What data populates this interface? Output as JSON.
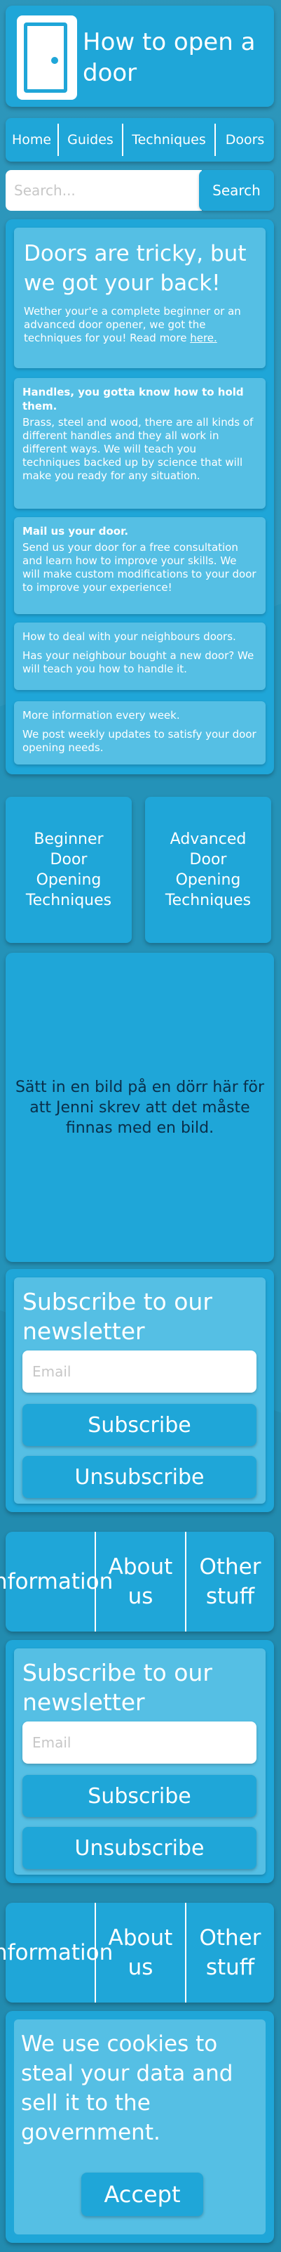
{
  "header": {
    "title": "How to open a door"
  },
  "nav": {
    "items": [
      "Home",
      "Guides",
      "Techniques",
      "Doors"
    ]
  },
  "search": {
    "placeholder": "Search...",
    "button_label": "Search"
  },
  "intro": {
    "title": "Doors are tricky, but we got your back!",
    "text": "Wether your'e a complete beginner or an advanced door opener, we got the techniques for you! Read more ",
    "link": "here."
  },
  "cards": [
    {
      "title": "Handles, you gotta know how to hold them.",
      "text": "Brass, steel and wood, there are all kinds of different handles and they all work in different ways. We will teach you techniques backed up by science that will make you ready for any situation."
    },
    {
      "title": "Mail us your door.",
      "text": "Send us your door for a free consultation and learn how to improve your skills. We will make custom modifications to your door to improve your experience!"
    },
    {
      "title": "How to deal with your neighbours doors.",
      "text": "Has your neighbour bought a new door? We will teach you how to handle it."
    },
    {
      "title": "More information every week.",
      "text": "We post weekly updates to satisfy your door opening needs."
    }
  ],
  "techniques": {
    "beginner": "Beginner Door Opening Techniques",
    "advanced": "Advanced Door Opening Techniques"
  },
  "image_placeholder": "Sätt in en bild på en dörr här för att Jenni skrev att det måste finnas med en bild.",
  "newsletter": {
    "title": "Subscribe to our newsletter",
    "email_placeholder": "Email",
    "subscribe_label": "Subscribe",
    "unsubscribe_label": "Unsubscribe"
  },
  "footer": {
    "items": [
      "Information",
      "About us",
      "Other stuff"
    ]
  },
  "cookie": {
    "text": "We use cookies to steal your data and sell it to the government.",
    "accept_label": "Accept"
  },
  "colors": {
    "background": "#2492b8",
    "primary": "#1fa6d8",
    "card": "#55bfe4"
  }
}
